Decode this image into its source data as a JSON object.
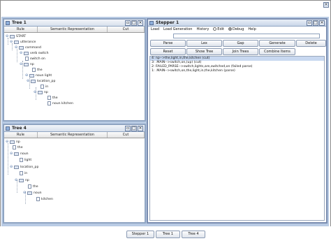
{
  "outer_close": "×",
  "tree1": {
    "title": "Tree 1",
    "columns": [
      "Rule",
      "Semantic Representation",
      "Cut"
    ],
    "nodes": [
      {
        "handle": "⊖",
        "icon": "folder",
        "label": "START"
      },
      {
        "handle": "⊖",
        "icon": "folder",
        "label": "utterance"
      },
      {
        "handle": "⊖",
        "icon": "folder",
        "label": "command"
      },
      {
        "handle": "⊖",
        "icon": "folder",
        "label": "verb switch"
      },
      {
        "handle": "",
        "icon": "leaf",
        "label": "switch on"
      },
      {
        "handle": "⊖",
        "icon": "folder",
        "label": "np"
      },
      {
        "handle": "",
        "icon": "leaf",
        "label": "the"
      },
      {
        "handle": "⊖",
        "icon": "folder",
        "label": "noun light"
      },
      {
        "handle": "⊖",
        "icon": "folder",
        "label": "location_pp"
      },
      {
        "handle": "",
        "icon": "leaf",
        "label": "in"
      },
      {
        "handle": "⊖",
        "icon": "folder",
        "label": "np"
      },
      {
        "handle": "",
        "icon": "leaf",
        "label": "the"
      },
      {
        "handle": "",
        "icon": "leaf",
        "label": "noun kitchen"
      }
    ]
  },
  "tree4": {
    "title": "Tree 4",
    "columns": [
      "Rule",
      "Semantic Representation",
      "Cut"
    ],
    "nodes": [
      {
        "handle": "⊖",
        "icon": "folder",
        "label": "np"
      },
      {
        "handle": "",
        "icon": "leaf",
        "label": "the"
      },
      {
        "handle": "⊖",
        "icon": "folder",
        "label": "noun"
      },
      {
        "handle": "",
        "icon": "leaf",
        "label": "light"
      },
      {
        "handle": "⊖",
        "icon": "folder",
        "label": "location_pp"
      },
      {
        "handle": "",
        "icon": "leaf",
        "label": "in"
      },
      {
        "handle": "⊖",
        "icon": "folder",
        "label": "np"
      },
      {
        "handle": "",
        "icon": "leaf",
        "label": "the"
      },
      {
        "handle": "⊖",
        "icon": "folder",
        "label": "noun"
      },
      {
        "handle": "",
        "icon": "leaf",
        "label": "kitchen"
      }
    ]
  },
  "stepper": {
    "title": "Stepper 1",
    "menu": {
      "load": "Load",
      "load_generation": "Load Generation",
      "history": "History",
      "edit": "Edit",
      "debug": "Debug",
      "help": "Help"
    },
    "search_value": "",
    "buttons_row1": [
      "Parse",
      "Lex",
      "Gap",
      "Generate",
      "Delete"
    ],
    "buttons_row2": [
      "Reset",
      "Show Tree",
      "Join Trees",
      "Combine Items"
    ],
    "output_lines": [
      "4: np-->the,light,in,the,kitchen (cut)",
      "3: .MAIN-->switch,on,(up) (cut)",
      "2: FAILED_PARSE-->switch,lights,are,switched,on (failed parse)",
      "1: .MAIN-->switch,on,the,light,in,the,kitchen (parse)"
    ]
  },
  "win_buttons": {
    "iconify": "▫",
    "maximize": "□",
    "close": "×"
  },
  "taskbar": {
    "items": [
      "Stepper 1",
      "Tree 1",
      "Tree 4"
    ]
  }
}
